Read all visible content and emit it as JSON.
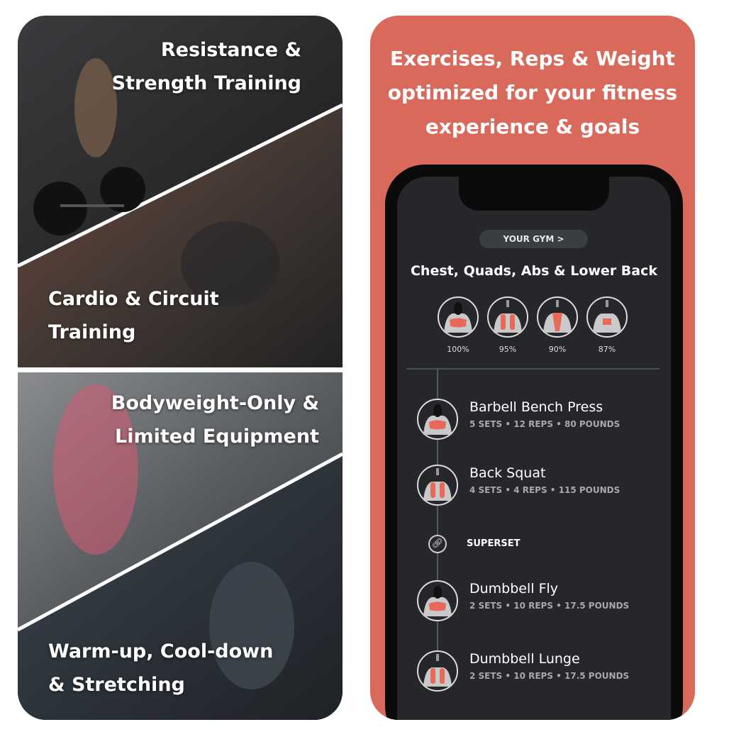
{
  "left_panel": {
    "sections": [
      {
        "lines": [
          "Resistance &",
          "Strength Training"
        ]
      },
      {
        "lines": [
          "Cardio & Circuit",
          "Training"
        ]
      },
      {
        "lines": [
          "Bodyweight-Only &",
          "Limited Equipment"
        ]
      },
      {
        "lines": [
          "Warm-up, Cool-down",
          "& Stretching"
        ]
      }
    ]
  },
  "right_panel": {
    "heading": [
      "Exercises, Reps & Weight",
      "optimized for your fitness",
      "experience & goals"
    ],
    "background_color": "#d9695a"
  },
  "app": {
    "gym_button": "YOUR GYM >",
    "workout_title": "Chest, Quads, Abs & Lower Back",
    "muscles": [
      {
        "name": "chest",
        "percent": "100%"
      },
      {
        "name": "quads",
        "percent": "95%"
      },
      {
        "name": "abs",
        "percent": "90%"
      },
      {
        "name": "lower-back",
        "percent": "87%"
      }
    ],
    "superset_label": "SUPERSET",
    "exercises": [
      {
        "name": "Barbell Bench Press",
        "details": "5 SETS • 12 REPS • 80 POUNDS",
        "muscle": "chest"
      },
      {
        "name": "Back Squat",
        "details": "4 SETS • 4 REPS • 115 POUNDS",
        "muscle": "quads"
      },
      {
        "name": "Dumbbell Fly",
        "details": "2 SETS • 10 REPS • 17.5 POUNDS",
        "muscle": "chest"
      },
      {
        "name": "Dumbbell Lunge",
        "details": "2 SETS • 10 REPS • 17.5 POUNDS",
        "muscle": "quads"
      }
    ],
    "highlight_color": "#e8695a"
  }
}
